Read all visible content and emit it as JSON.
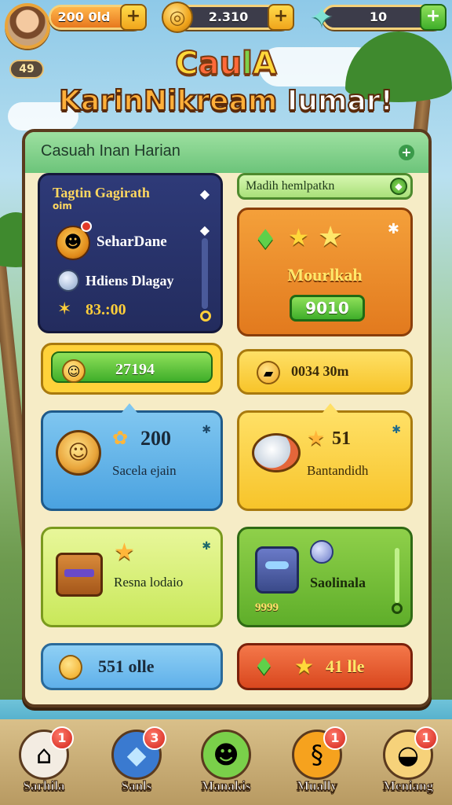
{
  "header": {
    "level": "49",
    "resources": [
      {
        "id": "energy",
        "value": "200 0ld",
        "fill_fraction": 0.85
      },
      {
        "id": "coins",
        "value": "2.310"
      },
      {
        "id": "gems",
        "value": "10"
      }
    ],
    "plus_label": "+"
  },
  "title": {
    "line1_parts": [
      "C",
      "au",
      "l",
      "A"
    ],
    "line2_main": "KarinNikream",
    "line2_tail": "Iumar!"
  },
  "panel": {
    "title": "Casuah Inan Harian",
    "quest": {
      "title": "Tagtin Gagirath",
      "subtitle": "oim",
      "row1": "SeharDane",
      "row2": "Hdiens Dlagay",
      "row3": "83.:00"
    },
    "mission_bar": "Madih hemlpatkn",
    "reward": {
      "label": "Mourlkah",
      "button": "9010"
    },
    "pill_green": "27194",
    "pill_yellow": "0034 30m",
    "mid_blue": {
      "number": "200",
      "text": "Sacela ejain"
    },
    "mid_yellow": {
      "number": "51",
      "text": "Bantandidh"
    },
    "low_lime": {
      "text": "Resna lodaio"
    },
    "low_green": {
      "text": "Saolinala",
      "coins": "9999"
    },
    "bot_blue": "551 olle",
    "bot_red": "41 lle"
  },
  "nav": [
    {
      "label": "Sarhila",
      "badge": "1",
      "icon": "house-icon",
      "color": "#f3ece2"
    },
    {
      "label": "Sanls",
      "badge": "3",
      "icon": "crystal-icon",
      "color": "#3a7ad0"
    },
    {
      "label": "Manakis",
      "badge": "1",
      "icon": "character-icon",
      "color": "#7ad04a"
    },
    {
      "label": "Mually",
      "badge": "1",
      "icon": "scroll-coin-icon",
      "color": "#f6a21e"
    },
    {
      "label": "Meniang",
      "badge": "1",
      "icon": "food-icon",
      "color": "#f6d27a"
    }
  ],
  "colors": {
    "panel_bg": "#f6ecc6",
    "panel_head": "#6cc47a",
    "accent_gold": "#ffd83a",
    "badge_red": "#d2231a"
  }
}
